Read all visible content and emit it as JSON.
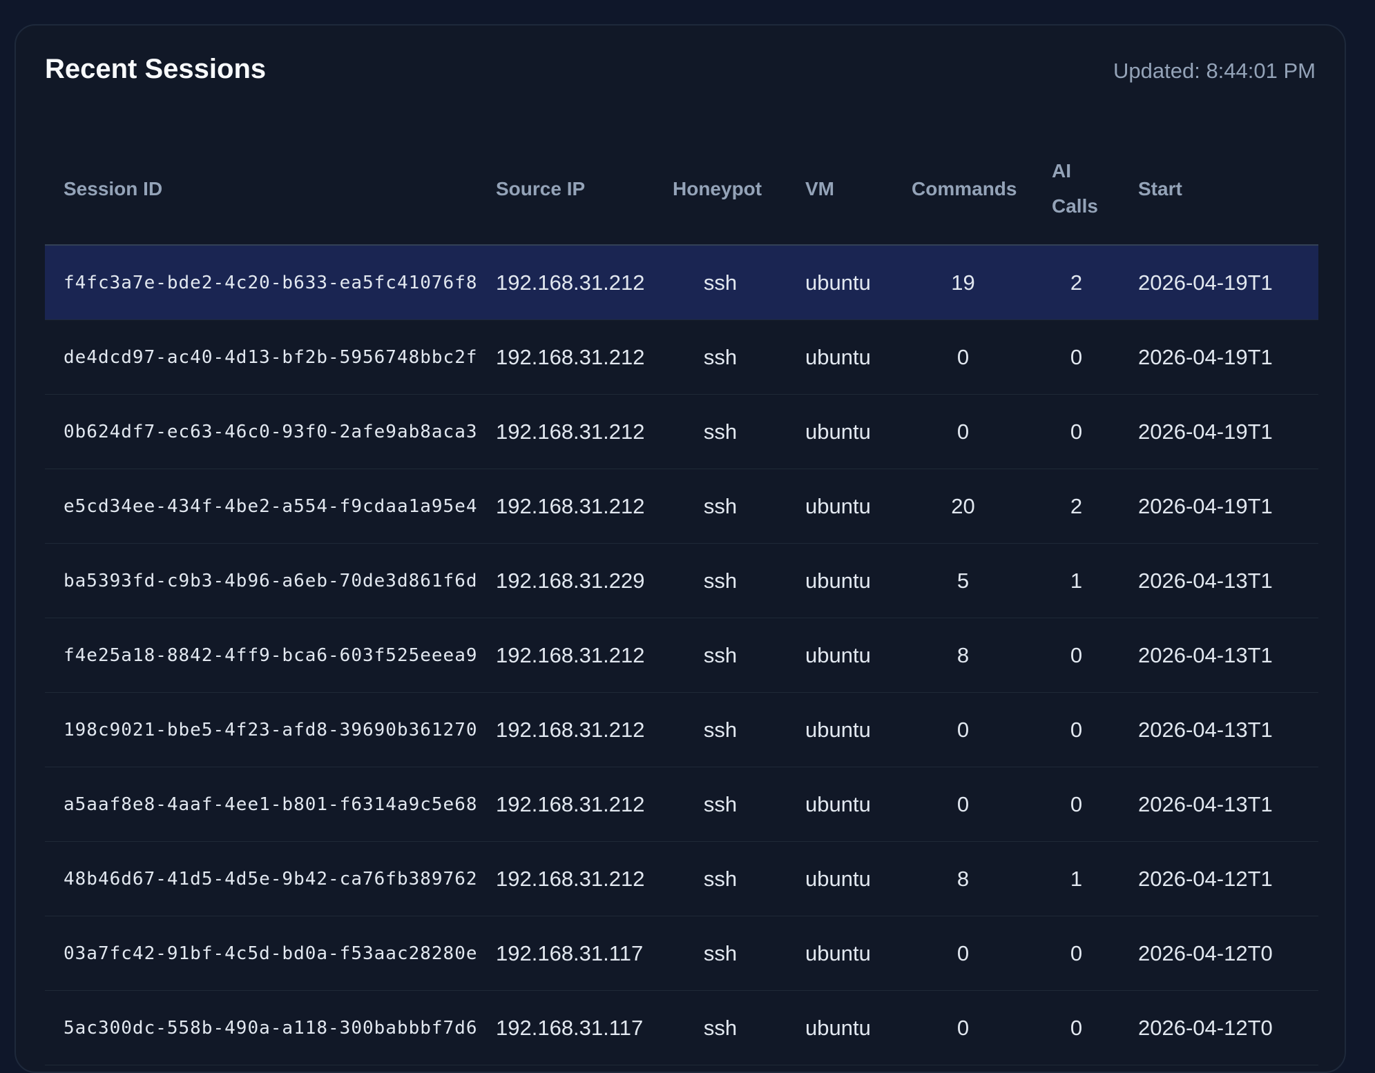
{
  "panel": {
    "title": "Recent Sessions",
    "updated": "Updated: 8:44:01 PM"
  },
  "table": {
    "headers": {
      "session_id": "Session ID",
      "source_ip": "Source IP",
      "honeypot": "Honeypot",
      "vm": "VM",
      "commands": "Commands",
      "ai_calls": "AI Calls",
      "start": "Start"
    },
    "rows": [
      {
        "session_id": "f4fc3a7e-bde2-4c20-b633-ea5fc41076f8",
        "source_ip": "192.168.31.212",
        "honeypot": "ssh",
        "vm": "ubuntu",
        "commands": "19",
        "ai_calls": "2",
        "start": "2026-04-19T1"
      },
      {
        "session_id": "de4dcd97-ac40-4d13-bf2b-5956748bbc2f",
        "source_ip": "192.168.31.212",
        "honeypot": "ssh",
        "vm": "ubuntu",
        "commands": "0",
        "ai_calls": "0",
        "start": "2026-04-19T1"
      },
      {
        "session_id": "0b624df7-ec63-46c0-93f0-2afe9ab8aca3",
        "source_ip": "192.168.31.212",
        "honeypot": "ssh",
        "vm": "ubuntu",
        "commands": "0",
        "ai_calls": "0",
        "start": "2026-04-19T1"
      },
      {
        "session_id": "e5cd34ee-434f-4be2-a554-f9cdaa1a95e4",
        "source_ip": "192.168.31.212",
        "honeypot": "ssh",
        "vm": "ubuntu",
        "commands": "20",
        "ai_calls": "2",
        "start": "2026-04-19T1"
      },
      {
        "session_id": "ba5393fd-c9b3-4b96-a6eb-70de3d861f6d",
        "source_ip": "192.168.31.229",
        "honeypot": "ssh",
        "vm": "ubuntu",
        "commands": "5",
        "ai_calls": "1",
        "start": "2026-04-13T1"
      },
      {
        "session_id": "f4e25a18-8842-4ff9-bca6-603f525eeea9",
        "source_ip": "192.168.31.212",
        "honeypot": "ssh",
        "vm": "ubuntu",
        "commands": "8",
        "ai_calls": "0",
        "start": "2026-04-13T1"
      },
      {
        "session_id": "198c9021-bbe5-4f23-afd8-39690b361270",
        "source_ip": "192.168.31.212",
        "honeypot": "ssh",
        "vm": "ubuntu",
        "commands": "0",
        "ai_calls": "0",
        "start": "2026-04-13T1"
      },
      {
        "session_id": "a5aaf8e8-4aaf-4ee1-b801-f6314a9c5e68",
        "source_ip": "192.168.31.212",
        "honeypot": "ssh",
        "vm": "ubuntu",
        "commands": "0",
        "ai_calls": "0",
        "start": "2026-04-13T1"
      },
      {
        "session_id": "48b46d67-41d5-4d5e-9b42-ca76fb389762",
        "source_ip": "192.168.31.212",
        "honeypot": "ssh",
        "vm": "ubuntu",
        "commands": "8",
        "ai_calls": "1",
        "start": "2026-04-12T1"
      },
      {
        "session_id": "03a7fc42-91bf-4c5d-bd0a-f53aac28280e",
        "source_ip": "192.168.31.117",
        "honeypot": "ssh",
        "vm": "ubuntu",
        "commands": "0",
        "ai_calls": "0",
        "start": "2026-04-12T0"
      },
      {
        "session_id": "5ac300dc-558b-490a-a118-300babbbf7d6",
        "source_ip": "192.168.31.117",
        "honeypot": "ssh",
        "vm": "ubuntu",
        "commands": "0",
        "ai_calls": "0",
        "start": "2026-04-12T0"
      }
    ],
    "selected_row": 0
  },
  "colors": {
    "page_bg": "#0f172a",
    "card_bg": "#111827",
    "selected_row_bg": "#1a2552",
    "header_text": "#94a3b8",
    "cell_text": "#e2e8f0"
  }
}
